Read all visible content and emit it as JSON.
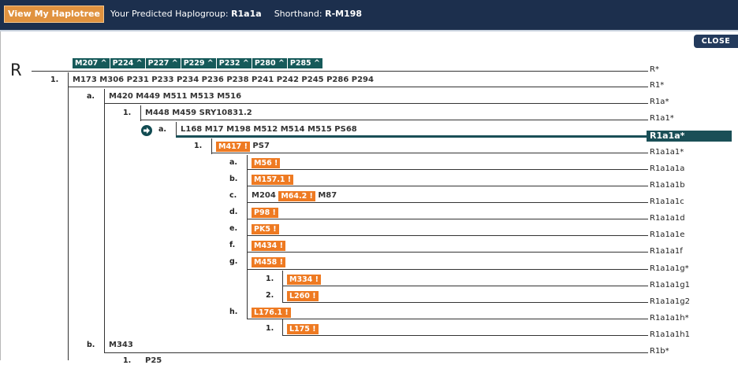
{
  "header": {
    "view_button": "View My Haplotree",
    "predicted_label": "Your Predicted Haplogroup:",
    "predicted_value": "R1a1a",
    "shorthand_label": "Shorthand:",
    "shorthand_value": "R-M198"
  },
  "close_button": "CLOSE",
  "tree": {
    "root": "R",
    "root_snps": [
      "M207 ^",
      "P224 ^",
      "P227 ^",
      "P229 ^",
      "P232 ^",
      "P280 ^",
      "P285 ^"
    ],
    "rows": [
      {
        "index": "1.",
        "snps": "M173 M306 P231 P233 P234 P236 P238 P241 P242 P245 P286 P294",
        "label": "R1*"
      },
      {
        "index": "a.",
        "snps": "M420 M449 M511 M513 M516",
        "label": "R1a*"
      },
      {
        "index": "1.",
        "snps": "M448 M459 SRY10831.2",
        "label": "R1a1*"
      },
      {
        "index": "a.",
        "snps": "L168 M17 M198 M512 M514 M515 PS68",
        "label": "R1a1a*"
      },
      {
        "index": "1.",
        "tag": "M417 !",
        "snps": "PS7",
        "label": "R1a1a1*"
      },
      {
        "index": "a.",
        "tag": "M56 !",
        "label": "R1a1a1a"
      },
      {
        "index": "b.",
        "tag": "M157.1 !",
        "label": "R1a1a1b"
      },
      {
        "index": "c.",
        "pre": "M204",
        "tag": "M64.2 !",
        "snps": "M87",
        "label": "R1a1a1c"
      },
      {
        "index": "d.",
        "tag": "P98 !",
        "label": "R1a1a1d"
      },
      {
        "index": "e.",
        "tag": "PK5 !",
        "label": "R1a1a1e"
      },
      {
        "index": "f.",
        "tag": "M434 !",
        "label": "R1a1a1f"
      },
      {
        "index": "g.",
        "tag": "M458 !",
        "label": "R1a1a1g*"
      },
      {
        "index": "1.",
        "tag": "M334 !",
        "label": "R1a1a1g1"
      },
      {
        "index": "2.",
        "tag": "L260 !",
        "label": "R1a1a1g2"
      },
      {
        "index": "h.",
        "tag": "L176.1 !",
        "label": "R1a1a1h*"
      },
      {
        "index": "1.",
        "tag": "L175 !",
        "label": "R1a1a1h1"
      },
      {
        "index": "b.",
        "snps": "M343",
        "label": "R1b*"
      },
      {
        "index": "1.",
        "snps": "P25"
      }
    ],
    "root_label": "R*"
  },
  "colors": {
    "header_bg": "#1c2f4d",
    "button": "#e0923f",
    "teal": "#1a4f57",
    "orange": "#ee7a22"
  }
}
